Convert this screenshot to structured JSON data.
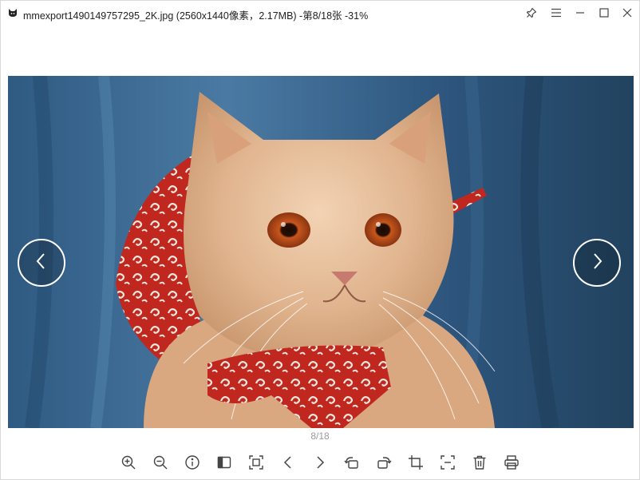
{
  "window": {
    "title": "mmexport1490149757295_2K.jpg (2560x1440像素，2.17MB) -第8/18张 -31%",
    "icons": {
      "app": "cat-logo-icon",
      "pin": "pin-icon",
      "menu": "hamburger-menu-icon",
      "minimize": "minimize-icon",
      "maximize": "maximize-icon",
      "close": "close-icon"
    }
  },
  "viewer": {
    "image_alt": "cat wearing red patterned scarf",
    "prev_icon": "chevron-left-icon",
    "next_icon": "chevron-right-icon",
    "page_indicator": "8/18"
  },
  "toolbar": {
    "tools": [
      "zoom-in-icon",
      "zoom-out-icon",
      "info-icon",
      "sidebar-icon",
      "fit-screen-icon",
      "previous-icon",
      "next-icon",
      "rotate-left-icon",
      "rotate-right-icon",
      "crop-icon",
      "actual-size-icon",
      "delete-icon",
      "print-icon"
    ]
  },
  "colors": {
    "icon": "#444444",
    "background": "#ffffff",
    "indicator": "#999999"
  }
}
